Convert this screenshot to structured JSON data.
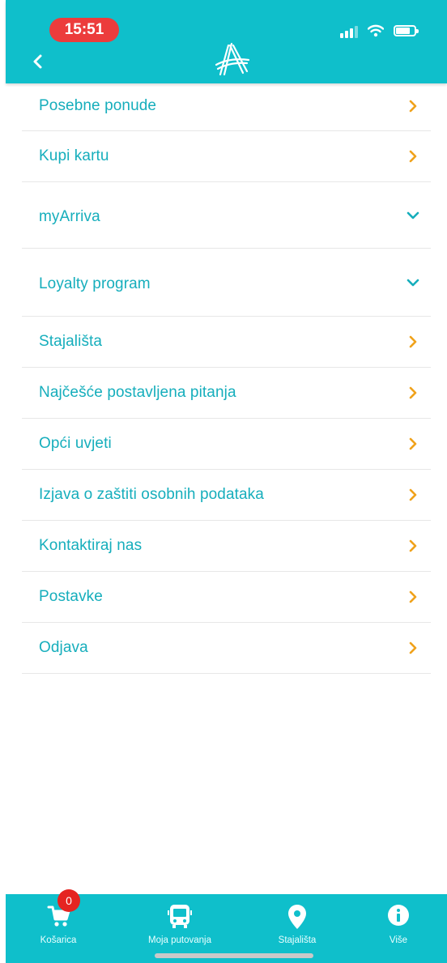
{
  "status_bar": {
    "time": "15:51"
  },
  "menu": {
    "items": [
      {
        "label": "Posebne ponude",
        "icon": "chevron-right-icon"
      },
      {
        "label": "Kupi kartu",
        "icon": "chevron-right-icon"
      },
      {
        "label": "myArriva",
        "icon": "chevron-down-icon"
      },
      {
        "label": "Loyalty program",
        "icon": "chevron-down-icon"
      },
      {
        "label": "Stajališta",
        "icon": "chevron-right-icon"
      },
      {
        "label": "Najčešće postavljena pitanja",
        "icon": "chevron-right-icon"
      },
      {
        "label": "Opći uvjeti",
        "icon": "chevron-right-icon"
      },
      {
        "label": "Izjava o zaštiti osobnih podataka",
        "icon": "chevron-right-icon"
      },
      {
        "label": "Kontaktiraj nas",
        "icon": "chevron-right-icon"
      },
      {
        "label": "Postavke",
        "icon": "chevron-right-icon"
      },
      {
        "label": "Odjava",
        "icon": "chevron-right-icon"
      }
    ]
  },
  "tabbar": {
    "cart_badge": "0",
    "tabs": [
      {
        "label": "Košarica",
        "icon": "cart-icon"
      },
      {
        "label": "Moja putovanja",
        "icon": "bus-icon"
      },
      {
        "label": "Stajališta",
        "icon": "location-pin-icon"
      },
      {
        "label": "Više",
        "icon": "info-icon"
      }
    ]
  },
  "colors": {
    "brand": "#0fbfcb",
    "link": "#16aebc",
    "chevron_right": "#f0a21b",
    "chevron_down": "#16aebc",
    "badge": "#e52421"
  }
}
